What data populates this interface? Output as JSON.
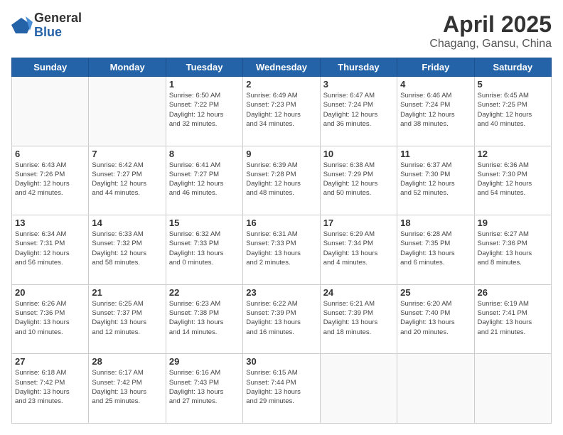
{
  "logo": {
    "general": "General",
    "blue": "Blue"
  },
  "title": "April 2025",
  "subtitle": "Chagang, Gansu, China",
  "weekdays": [
    "Sunday",
    "Monday",
    "Tuesday",
    "Wednesday",
    "Thursday",
    "Friday",
    "Saturday"
  ],
  "weeks": [
    [
      {
        "day": null
      },
      {
        "day": null
      },
      {
        "day": "1",
        "sunrise": "6:50 AM",
        "sunset": "7:22 PM",
        "daylight": "12 hours and 32 minutes."
      },
      {
        "day": "2",
        "sunrise": "6:49 AM",
        "sunset": "7:23 PM",
        "daylight": "12 hours and 34 minutes."
      },
      {
        "day": "3",
        "sunrise": "6:47 AM",
        "sunset": "7:24 PM",
        "daylight": "12 hours and 36 minutes."
      },
      {
        "day": "4",
        "sunrise": "6:46 AM",
        "sunset": "7:24 PM",
        "daylight": "12 hours and 38 minutes."
      },
      {
        "day": "5",
        "sunrise": "6:45 AM",
        "sunset": "7:25 PM",
        "daylight": "12 hours and 40 minutes."
      }
    ],
    [
      {
        "day": "6",
        "sunrise": "6:43 AM",
        "sunset": "7:26 PM",
        "daylight": "12 hours and 42 minutes."
      },
      {
        "day": "7",
        "sunrise": "6:42 AM",
        "sunset": "7:27 PM",
        "daylight": "12 hours and 44 minutes."
      },
      {
        "day": "8",
        "sunrise": "6:41 AM",
        "sunset": "7:27 PM",
        "daylight": "12 hours and 46 minutes."
      },
      {
        "day": "9",
        "sunrise": "6:39 AM",
        "sunset": "7:28 PM",
        "daylight": "12 hours and 48 minutes."
      },
      {
        "day": "10",
        "sunrise": "6:38 AM",
        "sunset": "7:29 PM",
        "daylight": "12 hours and 50 minutes."
      },
      {
        "day": "11",
        "sunrise": "6:37 AM",
        "sunset": "7:30 PM",
        "daylight": "12 hours and 52 minutes."
      },
      {
        "day": "12",
        "sunrise": "6:36 AM",
        "sunset": "7:30 PM",
        "daylight": "12 hours and 54 minutes."
      }
    ],
    [
      {
        "day": "13",
        "sunrise": "6:34 AM",
        "sunset": "7:31 PM",
        "daylight": "12 hours and 56 minutes."
      },
      {
        "day": "14",
        "sunrise": "6:33 AM",
        "sunset": "7:32 PM",
        "daylight": "12 hours and 58 minutes."
      },
      {
        "day": "15",
        "sunrise": "6:32 AM",
        "sunset": "7:33 PM",
        "daylight": "13 hours and 0 minutes."
      },
      {
        "day": "16",
        "sunrise": "6:31 AM",
        "sunset": "7:33 PM",
        "daylight": "13 hours and 2 minutes."
      },
      {
        "day": "17",
        "sunrise": "6:29 AM",
        "sunset": "7:34 PM",
        "daylight": "13 hours and 4 minutes."
      },
      {
        "day": "18",
        "sunrise": "6:28 AM",
        "sunset": "7:35 PM",
        "daylight": "13 hours and 6 minutes."
      },
      {
        "day": "19",
        "sunrise": "6:27 AM",
        "sunset": "7:36 PM",
        "daylight": "13 hours and 8 minutes."
      }
    ],
    [
      {
        "day": "20",
        "sunrise": "6:26 AM",
        "sunset": "7:36 PM",
        "daylight": "13 hours and 10 minutes."
      },
      {
        "day": "21",
        "sunrise": "6:25 AM",
        "sunset": "7:37 PM",
        "daylight": "13 hours and 12 minutes."
      },
      {
        "day": "22",
        "sunrise": "6:23 AM",
        "sunset": "7:38 PM",
        "daylight": "13 hours and 14 minutes."
      },
      {
        "day": "23",
        "sunrise": "6:22 AM",
        "sunset": "7:39 PM",
        "daylight": "13 hours and 16 minutes."
      },
      {
        "day": "24",
        "sunrise": "6:21 AM",
        "sunset": "7:39 PM",
        "daylight": "13 hours and 18 minutes."
      },
      {
        "day": "25",
        "sunrise": "6:20 AM",
        "sunset": "7:40 PM",
        "daylight": "13 hours and 20 minutes."
      },
      {
        "day": "26",
        "sunrise": "6:19 AM",
        "sunset": "7:41 PM",
        "daylight": "13 hours and 21 minutes."
      }
    ],
    [
      {
        "day": "27",
        "sunrise": "6:18 AM",
        "sunset": "7:42 PM",
        "daylight": "13 hours and 23 minutes."
      },
      {
        "day": "28",
        "sunrise": "6:17 AM",
        "sunset": "7:42 PM",
        "daylight": "13 hours and 25 minutes."
      },
      {
        "day": "29",
        "sunrise": "6:16 AM",
        "sunset": "7:43 PM",
        "daylight": "13 hours and 27 minutes."
      },
      {
        "day": "30",
        "sunrise": "6:15 AM",
        "sunset": "7:44 PM",
        "daylight": "13 hours and 29 minutes."
      },
      {
        "day": null
      },
      {
        "day": null
      },
      {
        "day": null
      }
    ]
  ]
}
